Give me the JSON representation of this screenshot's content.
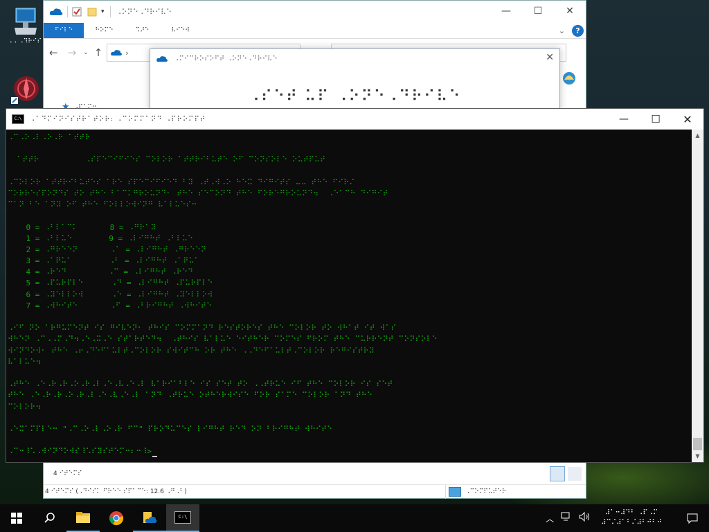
{
  "desktop": {
    "icons": [
      {
        "label": "⠄⠄⠠⠹⠗⠊⠎"
      },
      {
        "label": ""
      }
    ]
  },
  "explorer": {
    "title": "⠠⠕⠝⠑⠠⠙⠗⠊⠧⠑",
    "tabs": [
      "⠋⠊⠇⠑",
      "⠓⠕⠍⠑",
      "⠩⠜⠑",
      "⠧⠊⠑⠺"
    ],
    "nav_label": "⠠⠏⠁⠍⠒",
    "status_items": "4 ⠊⠞⠑⠍⠎",
    "footer_status": "4 ⠊⠞⠑⠍⠎ (⠠⠙⠊⠎⠅ ⠋⠗⠑⠑ ⠎⠏⠁⠉⠑: 12.6 ⠠⠛⠠⠃)",
    "footer_computer": "⠠⠉⠕⠍⠏⠥⠞⠑⠗"
  },
  "onedrive": {
    "title": "⠠⠍⠊⠉⠗⠕⠎⠕⠋⠞ ⠠⠕⠝⠑⠠⠙⠗⠊⠧⠑",
    "heading": "⠠⠎⠑⠞ ⠥⠏ ⠠⠕⠝⠑⠠⠙⠗⠊⠧⠑"
  },
  "cmd": {
    "title": "⠠⠁⠙⠍⠊⠝⠊⠎⠞⠗⠁⠞⠕⠗: ⠠⠉⠕⠍⠍⠁⠝⠙ ⠠⠏⠗⠕⠍⠏⠞",
    "lines": [
      "⠠⠉⠠⠕⠠⠇⠠⠕⠠⠗ ⠁⠞⠞⠗",
      "",
      "  ⠁⠞⠞⠗          ⠠⠎⠏⠑⠉⠊⠋⠊⠑⠎ ⠉⠕⠇⠕⠗ ⠁⠞⠞⠗⠊⠃⠥⠞⠑ ⠕⠋ ⠉⠕⠝⠎⠕⠇⠑ ⠕⠥⠞⠏⠥⠞",
      "",
      "⠠⠉⠕⠇⠕⠗ ⠁⠞⠞⠗⠊⠃⠥⠞⠑⠎ ⠁⠗⠑ ⠎⠏⠑⠉⠊⠋⠊⠑⠙ ⠃⠽ ⠠⠞⠠⠺⠠⠕ ⠓⠑⠭ ⠙⠊⠛⠊⠞⠎ ⠤⠤ ⠞⠓⠑ ⠋⠊⠗⠌",
      "⠉⠕⠗⠗⠑⠎⠏⠕⠝⠙⠎ ⠞⠕ ⠞⠓⠑ ⠃⠁⠉⠅⠛⠗⠕⠥⠝⠙⠂ ⠞⠓⠑ ⠎⠑⠉⠕⠝⠙ ⠞⠓⠑ ⠋⠕⠗⠑⠛⠗⠕⠥⠝⠙⠲  ⠠⠑⠁⠉⠓ ⠙⠊⠛⠊⠞",
      "⠉⠁⠝ ⠃⠑ ⠁⠝⠽ ⠕⠋ ⠞⠓⠑ ⠋⠕⠇⠇⠕⠺⠊⠝⠛ ⠧⠁⠇⠥⠑⠎⠒",
      "",
      "    0 = ⠠⠃⠇⠁⠉⠅       8 = ⠠⠛⠗⠁⠽",
      "    1 = ⠠⠃⠇⠥⠑        9 = ⠠⠇⠊⠛⠓⠞ ⠠⠃⠇⠥⠑",
      "    2 = ⠠⠛⠗⠑⠑⠝       ⠠⠁ = ⠠⠇⠊⠛⠓⠞ ⠠⠛⠗⠑⠑⠝",
      "    3 = ⠠⠁⠟⠥⠁        ⠠⠃ = ⠠⠇⠊⠛⠓⠞ ⠠⠁⠟⠥⠁",
      "    4 = ⠠⠗⠑⠙         ⠠⠉ = ⠠⠇⠊⠛⠓⠞ ⠠⠗⠑⠙",
      "    5 = ⠠⠏⠥⠗⠏⠇⠑      ⠠⠙ = ⠠⠇⠊⠛⠓⠞ ⠠⠏⠥⠗⠏⠇⠑",
      "    6 = ⠠⠽⠑⠇⠇⠕⠺      ⠠⠑ = ⠠⠇⠊⠛⠓⠞ ⠠⠽⠑⠇⠇⠕⠺",
      "    7 = ⠠⠺⠓⠊⠞⠑       ⠠⠋ = ⠠⠃⠗⠊⠛⠓⠞ ⠠⠺⠓⠊⠞⠑",
      "",
      "⠠⠊⠋ ⠝⠕ ⠁⠗⠛⠥⠍⠑⠝⠞ ⠊⠎ ⠛⠊⠧⠑⠝⠂ ⠞⠓⠊⠎ ⠉⠕⠍⠍⠁⠝⠙ ⠗⠑⠎⠞⠕⠗⠑⠎ ⠞⠓⠑ ⠉⠕⠇⠕⠗ ⠞⠕ ⠺⠓⠁⠞ ⠊⠞ ⠺⠁⠎",
      "⠺⠓⠑⠝ ⠠⠉⠠⠠⠍⠠⠙⠲⠠⠑⠠⠭⠠⠑ ⠎⠞⠁⠗⠞⠑⠙⠲  ⠠⠞⠓⠊⠎ ⠧⠁⠇⠥⠑ ⠑⠊⠞⠓⠑⠗ ⠉⠕⠍⠑⠎ ⠋⠗⠕⠍ ⠞⠓⠑ ⠉⠥⠗⠗⠑⠝⠞ ⠉⠕⠝⠎⠕⠇⠑",
      "⠺⠊⠝⠙⠕⠺⠂ ⠞⠓⠑ ⠠⠖⠠⠙⠑⠋⠁⠥⠇⠞⠠⠉⠕⠇⠕⠗ ⠎⠺⠊⠞⠉⠓ ⠕⠗ ⠞⠓⠑ ⠠⠠⠙⠑⠋⠁⠥⠇⠞⠠⠉⠕⠇⠕⠗ ⠗⠑⠛⠊⠎⠞⠗⠽",
      "⠧⠁⠇⠥⠑⠲",
      "",
      "⠠⠞⠓⠑ ⠠⠑⠠⠗⠠⠗⠠⠕⠠⠗⠠⠇⠠⠑⠠⠧⠠⠑⠠⠇ ⠧⠁⠗⠊⠁⠃⠇⠑ ⠊⠎ ⠎⠑⠞ ⠞⠕ ⠠⠠⠞⠗⠥⠑ ⠊⠋ ⠞⠓⠑ ⠉⠕⠇⠕⠗ ⠊⠎ ⠎⠑⠞",
      "⠞⠓⠑ ⠠⠑⠠⠗⠠⠗⠠⠕⠠⠗⠠⠇⠠⠑⠠⠧⠠⠑⠠⠇ ⠁⠝⠙ ⠠⠞⠗⠥⠑ ⠕⠞⠓⠑⠗⠺⠊⠎⠑ ⠋⠕⠗ ⠎⠁⠍⠑ ⠉⠕⠇⠕⠗ ⠁⠝⠙ ⠞⠓⠑",
      "⠉⠕⠇⠕⠗⠲",
      "",
      "⠠⠑⠭⠁⠍⠏⠇⠑⠒ \"⠠⠉⠠⠕⠠⠇⠠⠕⠠⠗ ⠋⠉\" ⠏⠗⠕⠙⠥⠉⠑⠎ ⠇⠊⠛⠓⠞ ⠗⠑⠙ ⠕⠝ ⠃⠗⠊⠛⠓⠞ ⠺⠓⠊⠞⠑",
      "",
      "⠠⠉⠒⠸⠡⠠⠺⠊⠝⠙⠕⠺⠎⠸⠡⠎⠽⠎⠞⠑⠍⠒⠆⠒⠸>"
    ]
  },
  "taskbar": {
    "items": [
      "start",
      "search",
      "file-explorer",
      "chrome",
      "onedrive-folder",
      "command-prompt"
    ],
    "clock_time": "⠼⠁⠒⠼⠙⠃ ⠠⠏⠠⠍",
    "clock_date": "⠼⠉⠌⠼⠁⠃⠌⠼⠃⠚⠃⠚"
  },
  "colors": {
    "cmd_text": "#13a10e",
    "ribbon_active": "#1a73c7",
    "taskbar": "#0a0a0a"
  }
}
